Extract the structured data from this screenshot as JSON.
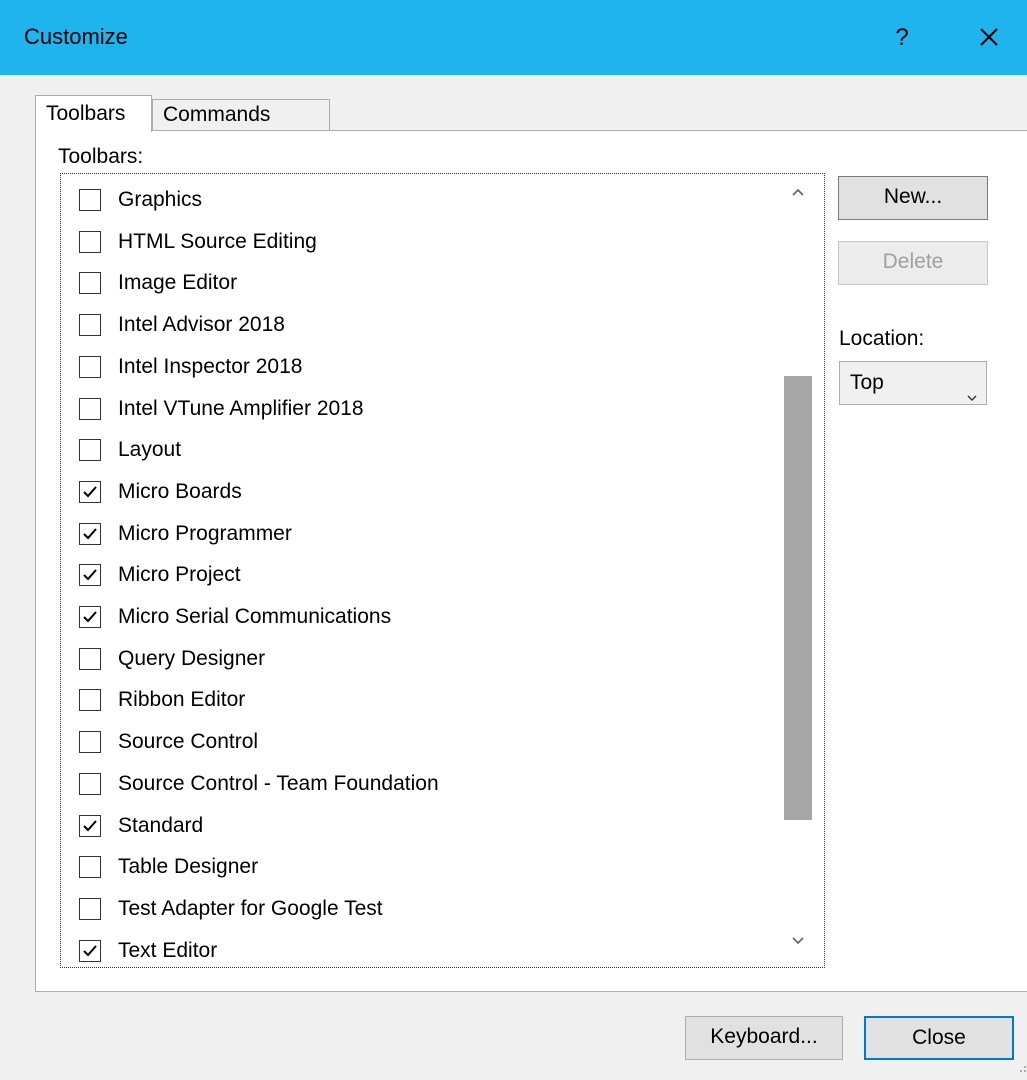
{
  "window": {
    "title": "Customize",
    "help_label": "?",
    "close_icon": "close-icon"
  },
  "tabs": [
    {
      "label": "Toolbars",
      "active": true
    },
    {
      "label": "Commands",
      "active": false
    }
  ],
  "toolbars_label": "Toolbars:",
  "toolbars": [
    {
      "label": "Graphics",
      "checked": false
    },
    {
      "label": "HTML Source Editing",
      "checked": false
    },
    {
      "label": "Image Editor",
      "checked": false
    },
    {
      "label": "Intel Advisor 2018",
      "checked": false
    },
    {
      "label": "Intel Inspector 2018",
      "checked": false
    },
    {
      "label": "Intel VTune Amplifier 2018",
      "checked": false
    },
    {
      "label": "Layout",
      "checked": false
    },
    {
      "label": "Micro Boards",
      "checked": true
    },
    {
      "label": "Micro Programmer",
      "checked": true
    },
    {
      "label": "Micro Project",
      "checked": true
    },
    {
      "label": "Micro Serial Communications",
      "checked": true
    },
    {
      "label": "Query Designer",
      "checked": false
    },
    {
      "label": "Ribbon Editor",
      "checked": false
    },
    {
      "label": "Source Control",
      "checked": false
    },
    {
      "label": "Source Control - Team Foundation",
      "checked": false
    },
    {
      "label": "Standard",
      "checked": true
    },
    {
      "label": "Table Designer",
      "checked": false
    },
    {
      "label": "Test Adapter for Google Test",
      "checked": false
    },
    {
      "label": "Text Editor",
      "checked": true
    }
  ],
  "buttons": {
    "new": "New...",
    "delete": "Delete",
    "keyboard": "Keyboard...",
    "close": "Close"
  },
  "location": {
    "label": "Location:",
    "selected": "Top"
  },
  "colors": {
    "titlebar": "#1fb4ee",
    "focus_border": "#0078d7",
    "scroll_thumb": "#a6a6a6"
  }
}
